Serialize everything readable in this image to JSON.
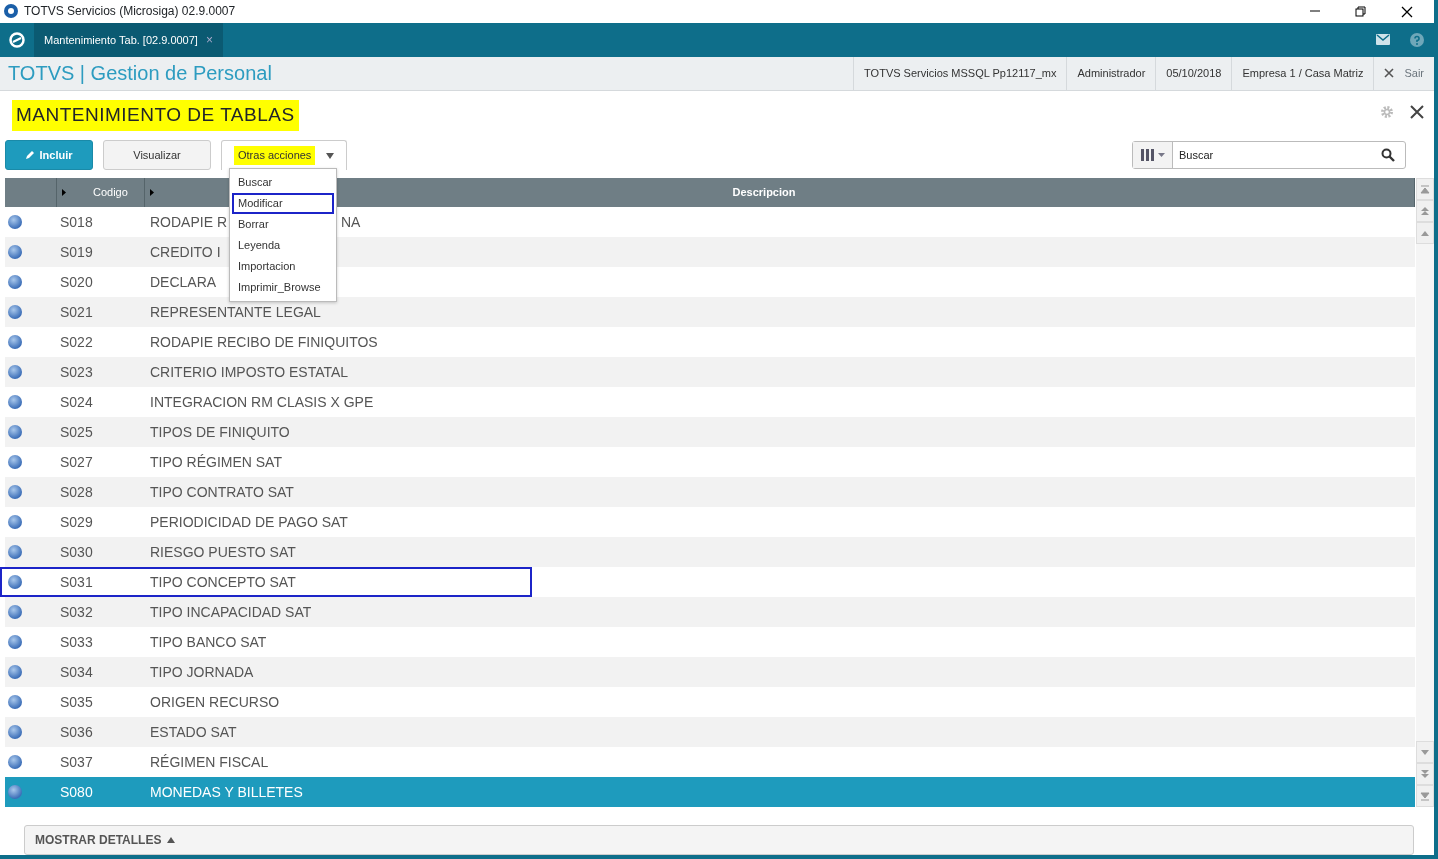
{
  "window": {
    "title": "TOTVS Servicios (Microsiga) 02.9.0007"
  },
  "tabs": [
    {
      "label": "Mantenimiento Tab. [02.9.0007]",
      "close": "×",
      "selected": true
    }
  ],
  "header": {
    "app_title": "TOTVS | Gestion de Personal",
    "info": [
      "TOTVS Servicios MSSQL Pp12117_mx",
      "Administrador",
      "05/10/2018",
      "Empresa 1 / Casa Matriz"
    ],
    "exit": "Sair"
  },
  "page": {
    "title": "MANTENIMIENTO DE TABLAS",
    "highlighted": true
  },
  "toolbar": {
    "buttons": [
      {
        "label": "Incluir",
        "kind": "primary",
        "highlighted": false
      },
      {
        "label": "Visualizar",
        "kind": "default",
        "highlighted": false
      },
      {
        "label": "Otras acciones",
        "kind": "dropdown",
        "highlighted": true,
        "expanded": true
      }
    ],
    "menu": [
      {
        "label": "Buscar",
        "annotated": false
      },
      {
        "label": "Modificar",
        "annotated": true
      },
      {
        "label": "Borrar",
        "annotated": false
      },
      {
        "label": "Leyenda",
        "annotated": false
      },
      {
        "label": "Importacion",
        "annotated": false
      },
      {
        "label": "Imprimir_Browse",
        "annotated": false
      }
    ],
    "search": {
      "placeholder": "Buscar"
    }
  },
  "table": {
    "columns": [
      "Codigo",
      "Descripcion"
    ],
    "rows": [
      {
        "code": "S018",
        "description": "RODAPIE R",
        "description_after_menu": "NA",
        "selected": false,
        "annotated": false
      },
      {
        "code": "S019",
        "description": "CREDITO I",
        "selected": false,
        "annotated": false
      },
      {
        "code": "S020",
        "description": "DECLARA",
        "selected": false,
        "annotated": false
      },
      {
        "code": "S021",
        "description": "REPRESENTANTE LEGAL",
        "selected": false,
        "annotated": false
      },
      {
        "code": "S022",
        "description": "RODAPIE RECIBO DE FINIQUITOS",
        "selected": false,
        "annotated": false
      },
      {
        "code": "S023",
        "description": "CRITERIO IMPOSTO ESTATAL",
        "selected": false,
        "annotated": false
      },
      {
        "code": "S024",
        "description": "INTEGRACION RM CLASIS X GPE",
        "selected": false,
        "annotated": false
      },
      {
        "code": "S025",
        "description": "TIPOS DE FINIQUITO",
        "selected": false,
        "annotated": false
      },
      {
        "code": "S027",
        "description": "TIPO RÉGIMEN SAT",
        "selected": false,
        "annotated": false
      },
      {
        "code": "S028",
        "description": "TIPO CONTRATO SAT",
        "selected": false,
        "annotated": false
      },
      {
        "code": "S029",
        "description": "PERIODICIDAD DE PAGO SAT",
        "selected": false,
        "annotated": false
      },
      {
        "code": "S030",
        "description": "RIESGO PUESTO SAT",
        "selected": false,
        "annotated": false
      },
      {
        "code": "S031",
        "description": "TIPO CONCEPTO SAT",
        "selected": false,
        "annotated": true
      },
      {
        "code": "S032",
        "description": "TIPO INCAPACIDAD SAT",
        "selected": false,
        "annotated": false
      },
      {
        "code": "S033",
        "description": "TIPO BANCO SAT",
        "selected": false,
        "annotated": false
      },
      {
        "code": "S034",
        "description": "TIPO JORNADA",
        "selected": false,
        "annotated": false
      },
      {
        "code": "S035",
        "description": "ORIGEN RECURSO",
        "selected": false,
        "annotated": false
      },
      {
        "code": "S036",
        "description": "ESTADO SAT",
        "selected": false,
        "annotated": false
      },
      {
        "code": "S037",
        "description": "RÉGIMEN FISCAL",
        "selected": false,
        "annotated": false
      },
      {
        "code": "S080",
        "description": "MONEDAS Y BILLETES",
        "selected": true,
        "annotated": false
      }
    ]
  },
  "footer": {
    "details_button": "MOSTRAR DETALLES"
  }
}
